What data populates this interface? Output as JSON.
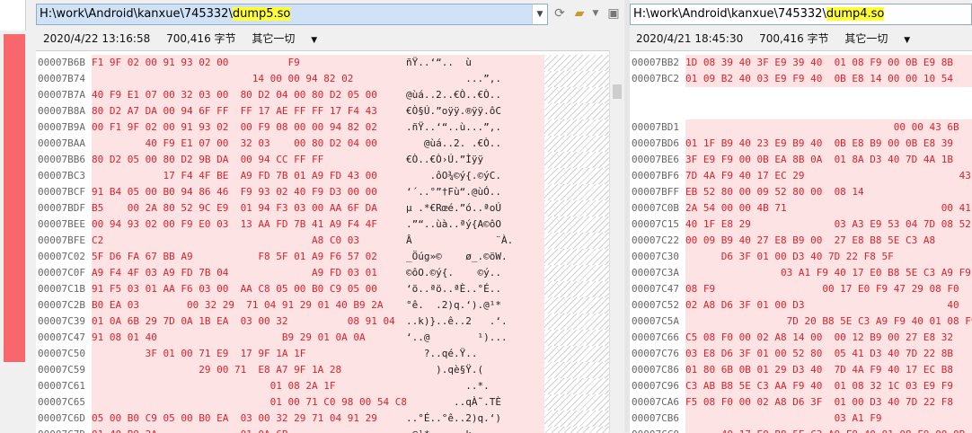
{
  "left": {
    "path_prefix": "H:\\work\\Android\\kanxue\\745332\\",
    "path_file": "dump5.so",
    "date": "2020/4/22 13:16:58",
    "size": "700,416 字节",
    "encoding": "其它一切",
    "rows": [
      {
        "a": "00007B6B",
        "h": "F1 9F 02 00 91 93 02 00          F9               ",
        "t": "ñŸ..‘“..  ù      "
      },
      {
        "a": "00007B74",
        "h": "                           14 00 00 94 82 02    ",
        "t": "          ...”,. "
      },
      {
        "a": "00007B7A",
        "h": "40 F9 E1 07 00 32 03 00  80 D2 04 00 80 D2 05 00",
        "t": "@ùá..2..€Ò..€Ò.."
      },
      {
        "a": "00007B8A",
        "h": "80 D2 A7 DA 00 94 6F FF  FF 17 AE FF FF 17 F4 43",
        "t": "€Ò§Ú.”oÿÿ.®ÿÿ.ôC"
      },
      {
        "a": "00007B9A",
        "h": "00 F1 9F 02 00 91 93 02  00 F9 08 00 00 94 82 02",
        "t": ".ñŸ..‘“..ù...”,."
      },
      {
        "a": "00007BAA",
        "h": "         40 F9 E1 07 00  32 03    00 80 D2 04 00",
        "t": "   @ùá..2. .€Ò.."
      },
      {
        "a": "00007BB6",
        "h": "80 D2 05 00 80 D2 9B DA  00 94 CC FF FF          ",
        "t": "€Ò..€Ò›Ú.”Ìÿÿ    "
      },
      {
        "a": "00007BC3",
        "h": "            17 F4 4F BE  A9 FD 7B 01 A9 FD 43 00",
        "t": "    .ôO¾©ý{.©ýC."
      },
      {
        "a": "00007BCF",
        "h": "91 B4 05 00 B0 94 86 46  F9 93 02 40 F9 D3 00 00",
        "t": "‘´..°”†Fù“.@ùÓ.."
      },
      {
        "a": "00007BDF",
        "h": "B5    00 2A 80 52 9C E9  01 94 F3 03 00 AA 6F DA",
        "t": "µ .*€Rœé.”ó..ªoÚ"
      },
      {
        "a": "00007BEE",
        "h": "00 94 93 02 00 F9 E0 03  13 AA FD 7B 41 A9 F4 4F",
        "t": ".”“..ùà..ªý{A©ôO"
      },
      {
        "a": "00007BFE",
        "h": "C2                                   A8 C0 03  ",
        "t": "Â              ¨À."
      },
      {
        "a": "00007C02",
        "h": "5F D6 FA 67 BB A9           F8 5F 01 A9 F6 57 02",
        "t": "_Öúg»©    ø_.©öW."
      },
      {
        "a": "00007C0F",
        "h": "A9 F4 4F 03 A9 FD 7B 04              A9 FD 03 01",
        "t": "©ôO.©ý{.    ©ý.."
      },
      {
        "a": "00007C1B",
        "h": "91 F5 03 01 AA F6 03 00  AA C8 05 00 B0 C9 05 00",
        "t": "‘õ..ªö..ªÈ..°É.."
      },
      {
        "a": "00007C2B",
        "h": "B0 EA 03        00 32 29  71 04 91 29 01 40 B9 2A",
        "t": "°ê.  .2)q.‘).@¹*"
      },
      {
        "a": "00007C39",
        "h": "01 0A 6B 29 7D 0A 1B EA  03 00 32          08 91 04",
        "t": "..k)}..ê..2   .‘."
      },
      {
        "a": "00007C47",
        "h": "91 08 01 40                     B9 29 01 0A 0A  ",
        "t": "‘..@        ¹)..."
      },
      {
        "a": "00007C50",
        "h": "         3F 01 00 71 E9  17 9F 1A 1F             ",
        "t": "   ?..qé.Ÿ..     "
      },
      {
        "a": "00007C59",
        "h": "                  29 00 71  E8 A7 9F 1A 28        ",
        "t": "     ).qè§Ÿ.(    "
      },
      {
        "a": "00007C61",
        "h": "                              01 08 2A 1F       ",
        "t": "          ..*.   "
      },
      {
        "a": "00007C65",
        "h": "                              01 00 71 C0 98 00 54 C8",
        "t": "        ..qÀ˜.TÈ"
      },
      {
        "a": "00007C6D",
        "h": "05 00 B0 C9 05 00 B0 EA  03 00 32 29 71 04 91 29",
        "t": "..°É..°ê..2)q.‘)"
      },
      {
        "a": "00007C7D",
        "h": "01 40 B9 2A              01 0A 6B              ",
        "t": ".@¹*    ..k      "
      }
    ]
  },
  "right": {
    "path_prefix": "H:\\work\\Android\\kanxue\\745332\\",
    "path_file": "dump4.so",
    "date": "2020/4/21 18:45:30",
    "size": "700,416 字节",
    "encoding": "其它一切",
    "rows": [
      {
        "a": "00007BB2",
        "h": "1D 08 39 40 3F E9 39 40  01 08 F9 00 0B E9 8B"
      },
      {
        "a": "00007BC2",
        "h": "01 09 B2 40 03 E9 F9 40  0B E8 14 00 00 10 54"
      },
      {
        "a": "",
        "h": ""
      },
      {
        "a": "",
        "h": ""
      },
      {
        "a": "00007BD1",
        "h": "                                   00 00 43 6B"
      },
      {
        "a": "00007BD6",
        "h": "01 1F B9 40 23 E9 B9 40  0B E8 B9 00 0B E8 39"
      },
      {
        "a": "00007BE6",
        "h": "3F E9 F9 00 0B EA 8B 0A  01 8A D3 40 7D 4A 1B"
      },
      {
        "a": "00007BF6",
        "h": "7D 4A F9 40 17 EC 29                          43"
      },
      {
        "a": "00007BFF",
        "h": "EB 52 80 00 09 52 80 00  08 14                  "
      },
      {
        "a": "00007C0B",
        "h": "2A 54 00 00 4B 71                          00 41 1F"
      },
      {
        "a": "00007C15",
        "h": "40 1F E8 29              03 A3 E9 53 04 7D 08 52"
      },
      {
        "a": "00007C22",
        "h": "00 09 B9 40 27 E8 B9 00  27 E8 B8 5E C3 A8     "
      },
      {
        "a": "00007C30",
        "h": "      D6 3F 01 00 D3 40 7D 22 F8 5F           "
      },
      {
        "a": "00007C3A",
        "h": "                03 A1 F9 40 17 E0 B8 5E C3 A9 F9 40"
      },
      {
        "a": "00007C47",
        "h": "08 F9                  00 17 E0 F9 47 29 08 F0"
      },
      {
        "a": "00007C52",
        "h": "02 A8 D6 3F 01 00 D3                        40  "
      },
      {
        "a": "00007C5A",
        "h": "                 7D 20 B8 5E C3 A9 F9 40 01 08 F9"
      },
      {
        "a": "00007C66",
        "h": "C5 08 F0 00 02 A8 14 00  00 12 B9 00 27 E8 32"
      },
      {
        "a": "00007C76",
        "h": "03 E8 D6 3F 01 00 52 80  05 41 D3 40 7D 22 8B"
      },
      {
        "a": "00007C86",
        "h": "01 80 6B 0B 01 29 D3 40  7D 4A F9 40 17 EC B8"
      },
      {
        "a": "00007C96",
        "h": "C3 AB B8 5E C3 AA F9 40  01 08 32 1C 03 E9 F9"
      },
      {
        "a": "00007CA6",
        "h": "F5 08 F0 00 02 A8 D6 3F  01 00 D3 40 7D 22 F8"
      },
      {
        "a": "00007CB6",
        "h": "                         03 A1 F9            "
      },
      {
        "a": "00007CC0",
        "h": "      40 17 E0 B8 5E C3 A9 F9 40 01 08 F9 00 0B"
      }
    ]
  }
}
